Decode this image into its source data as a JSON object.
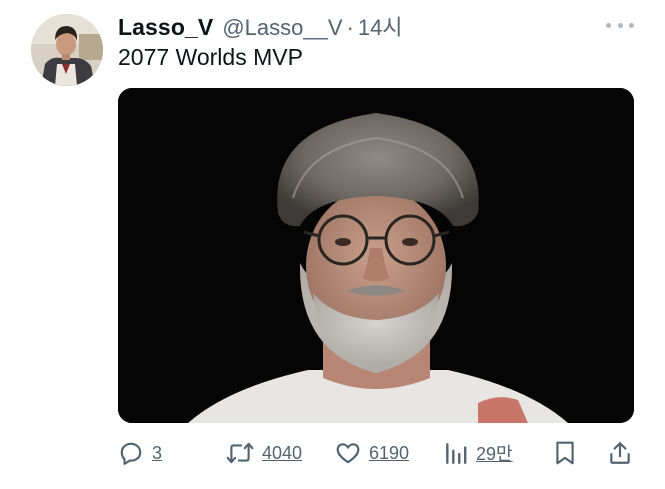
{
  "tweet": {
    "display_name": "Lasso_V",
    "handle": "@Lasso__V",
    "separator": "·",
    "time": "14시",
    "text": "2077 Worlds MVP",
    "avatar_icon": "profile-avatar",
    "media_description_icon": "photo"
  },
  "actions": {
    "reply": {
      "icon": "reply-icon",
      "count": "3"
    },
    "retweet": {
      "icon": "retweet-icon",
      "count": "4040"
    },
    "like": {
      "icon": "heart-icon",
      "count": "6190"
    },
    "views": {
      "icon": "views-icon",
      "count": "29만"
    },
    "bookmark": {
      "icon": "bookmark-icon"
    },
    "share": {
      "icon": "share-icon"
    }
  },
  "colors": {
    "text_primary": "#0f1419",
    "text_secondary": "#536471",
    "media_background": "#050505"
  }
}
